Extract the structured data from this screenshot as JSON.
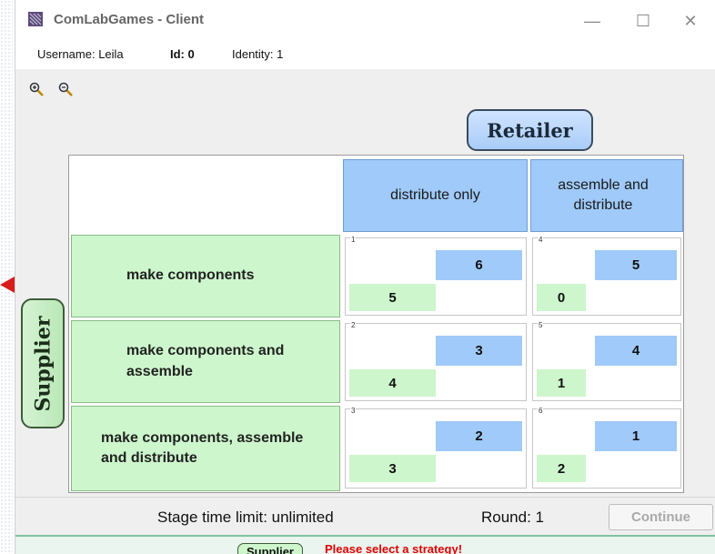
{
  "window": {
    "title": "ComLabGames - Client",
    "min_label": "—",
    "max_label": "☐",
    "close_label": "✕"
  },
  "user": {
    "username_label": "Username: Leila",
    "id_label": "Id: 0",
    "identity_label": "Identity: 1"
  },
  "toolbar": {
    "zoom_in_icon": "zoom-in-icon",
    "zoom_out_icon": "zoom-out-icon"
  },
  "players": {
    "column_player": "Retailer",
    "row_player": "Supplier"
  },
  "matrix": {
    "columns": [
      "distribute only",
      "assemble and distribute"
    ],
    "rows": [
      "make components",
      "make components and assemble",
      "make components, assemble and distribute"
    ],
    "cells": [
      [
        {
          "id": "1",
          "retailer": "6",
          "supplier": "5"
        },
        {
          "id": "4",
          "retailer": "5",
          "supplier": "0"
        }
      ],
      [
        {
          "id": "2",
          "retailer": "3",
          "supplier": "4"
        },
        {
          "id": "5",
          "retailer": "4",
          "supplier": "1"
        }
      ],
      [
        {
          "id": "3",
          "retailer": "2",
          "supplier": "3"
        },
        {
          "id": "6",
          "retailer": "1",
          "supplier": "2"
        }
      ]
    ]
  },
  "status": {
    "stage_limit": "Stage time limit: unlimited",
    "round": "Round: 1",
    "continue_label": "Continue",
    "role_badge": "Supplier",
    "prompt": "Please select a strategy!"
  },
  "colors": {
    "retailer_blue": "#9fcaf9",
    "supplier_green": "#cdf6cc",
    "prompt_red": "#e30000"
  }
}
